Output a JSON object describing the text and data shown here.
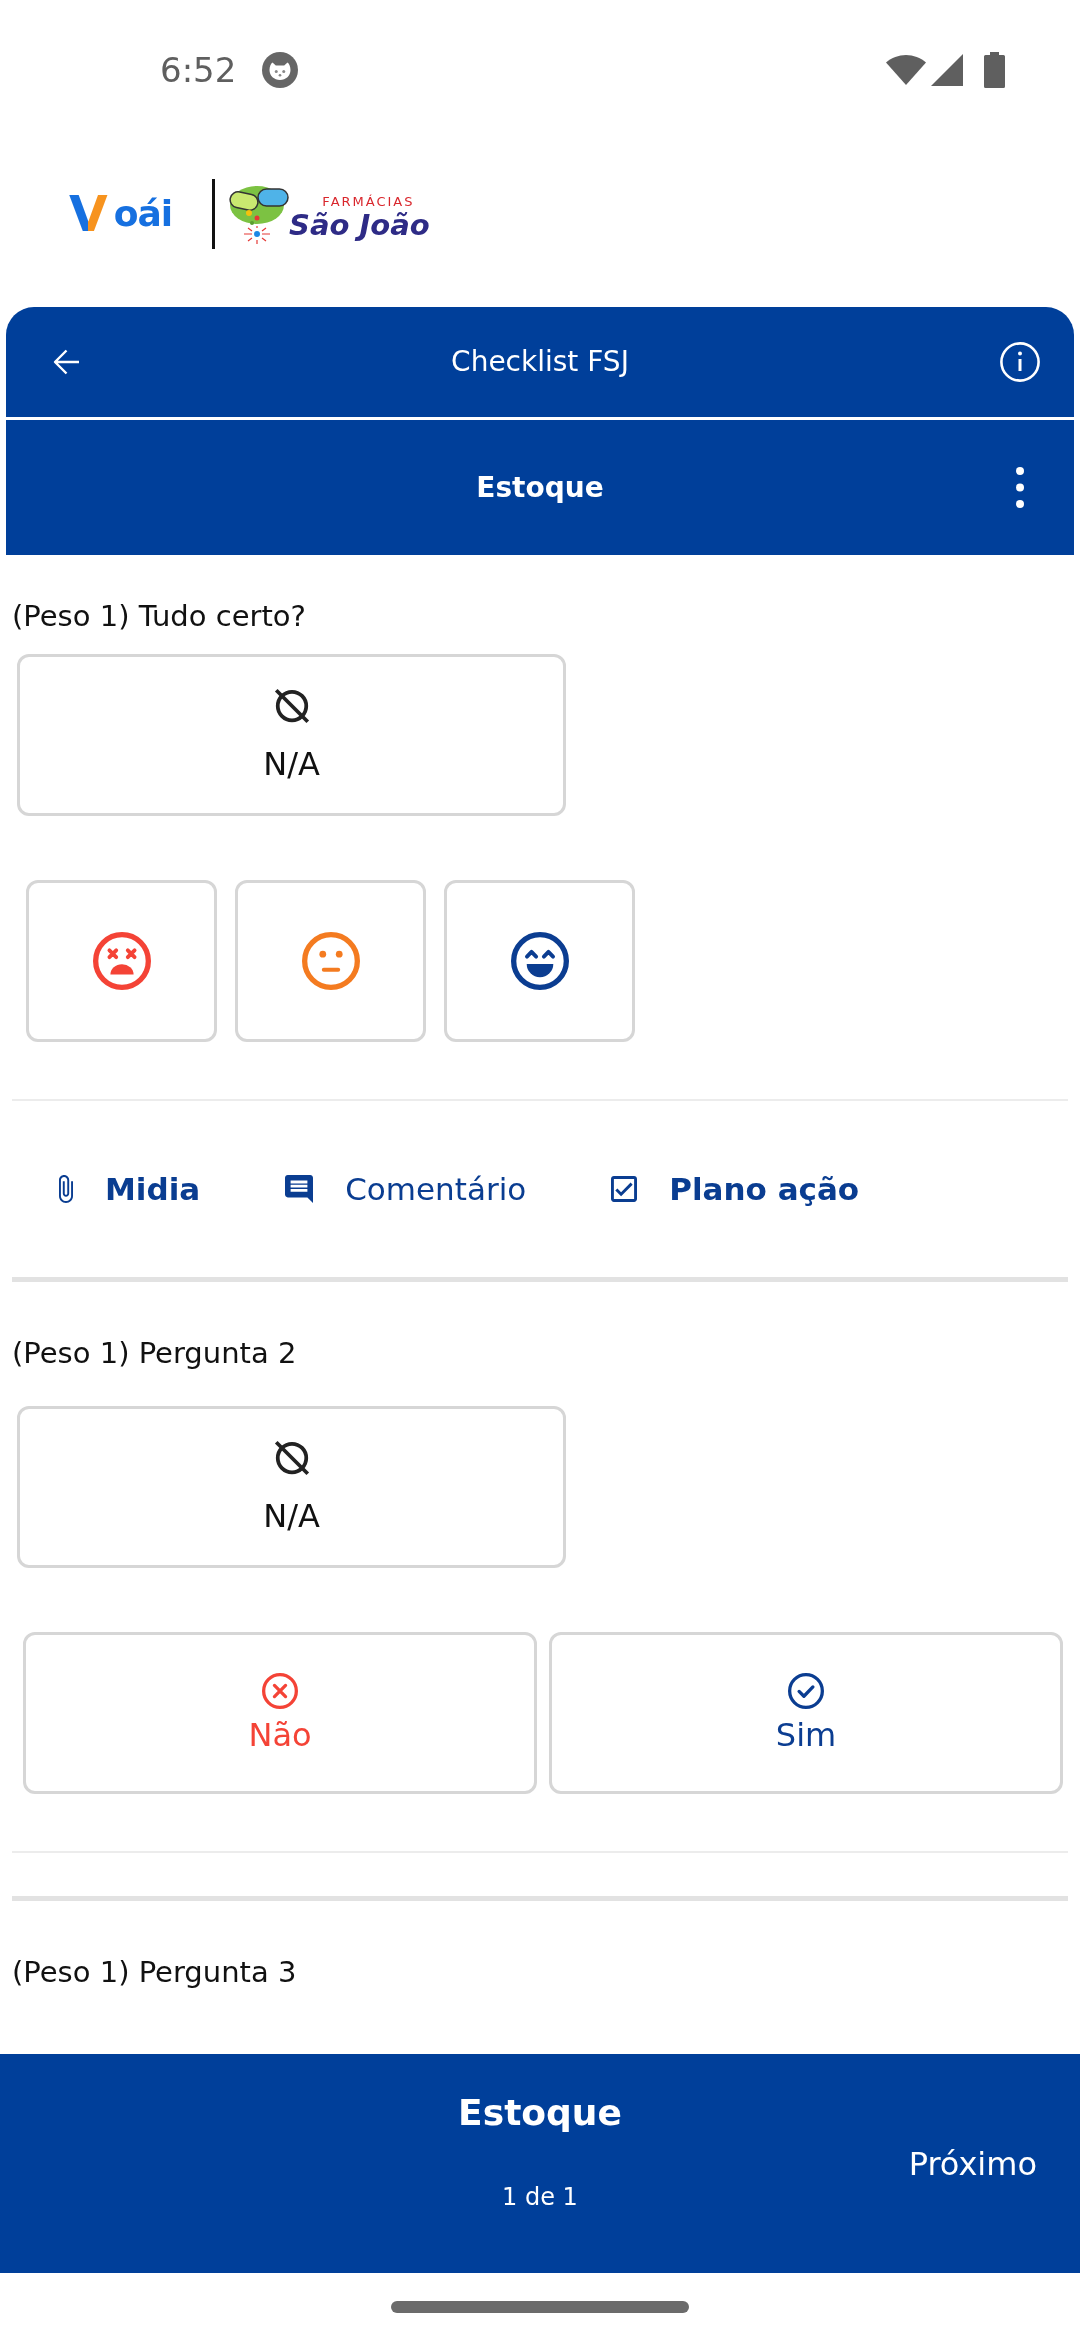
{
  "status_bar": {
    "time": "6:52"
  },
  "logos": {
    "app": {
      "mark": "V",
      "name": "oái"
    },
    "partner": {
      "tagline": "FARMÁCIAS",
      "name": "São João"
    }
  },
  "header": {
    "title": "Checklist FSJ"
  },
  "section_bar": {
    "title": "Estoque"
  },
  "questions": [
    {
      "label": "(Peso 1) Tudo certo?",
      "na": {
        "label": "N/A",
        "selected": false
      },
      "answers": {
        "kind": "rating",
        "options": [
          {
            "kind": "sad",
            "color": "#f44336",
            "selected": false
          },
          {
            "kind": "neutral",
            "color": "#f47b20",
            "selected": false
          },
          {
            "kind": "happy",
            "color": "#0b3d91",
            "selected": false
          }
        ]
      },
      "actions": [
        {
          "kind": "attachment",
          "label": "Midia",
          "emphasized": true
        },
        {
          "kind": "comment",
          "label": "Comentário",
          "emphasized": false
        },
        {
          "kind": "checklist",
          "label": "Plano ação",
          "emphasized": true
        }
      ]
    },
    {
      "label": "(Peso 1) Pergunta 2",
      "na": {
        "label": "N/A",
        "selected": false
      },
      "answers": {
        "kind": "yes_no",
        "options": [
          {
            "kind": "no",
            "label": "Não",
            "color": "#f44336",
            "selected": false
          },
          {
            "kind": "yes",
            "label": "Sim",
            "color": "#0b3d91",
            "selected": false
          }
        ]
      }
    },
    {
      "label": "(Peso 1) Pergunta 3"
    }
  ],
  "footer": {
    "title": "Estoque",
    "page": "1 de 1",
    "next": "Próximo"
  }
}
